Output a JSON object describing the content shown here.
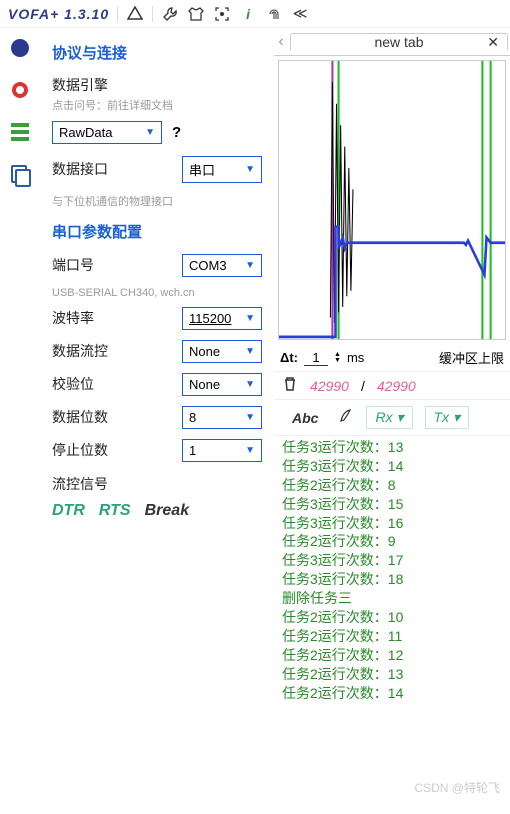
{
  "titlebar": {
    "title": "VOFA+ 1.3.10"
  },
  "leftPanel": {
    "protocol": {
      "title": "协议与连接"
    },
    "engine": {
      "label": "数据引擎",
      "hint": "点击问号：前往详细文档",
      "value": "RawData",
      "help": "?"
    },
    "interface": {
      "label": "数据接口",
      "value": "串口",
      "hint": "与下位机通信的物理接口"
    },
    "serial": {
      "title": "串口参数配置",
      "port": {
        "label": "端口号",
        "value": "COM3",
        "hint": "USB-SERIAL CH340, wch.cn"
      },
      "baud": {
        "label": "波特率",
        "value": "115200"
      },
      "flow": {
        "label": "数据流控",
        "value": "None"
      },
      "parity": {
        "label": "校验位",
        "value": "None"
      },
      "databits": {
        "label": "数据位数",
        "value": "8"
      },
      "stopbits": {
        "label": "停止位数",
        "value": "1"
      },
      "flowsig": {
        "label": "流控信号",
        "dtr": "DTR",
        "rts": "RTS",
        "brk": "Break"
      }
    }
  },
  "rightPanel": {
    "tab": {
      "label": "new tab"
    },
    "dt": {
      "label": "Δt:",
      "value": "1",
      "unit": "ms",
      "buffer_label": "缓冲区上限"
    },
    "buffer": {
      "current": "42990",
      "sep": "/",
      "total": "42990"
    },
    "msgTabs": {
      "abc": "Abc",
      "rx": "Rx",
      "tx": "Tx"
    },
    "log": [
      "任务3运行次数：13",
      "任务3运行次数：14",
      "任务2运行次数：8",
      "任务3运行次数：15",
      "任务3运行次数：16",
      "任务2运行次数：9",
      "任务3运行次数：17",
      "任务3运行次数：18",
      "删除任务三",
      "任务2运行次数：10",
      "任务2运行次数：11",
      "任务2运行次数：12",
      "任务2运行次数：13",
      "任务2运行次数：14"
    ]
  },
  "watermark": "CSDN @特轮飞",
  "chart_data": {
    "type": "line",
    "title": "",
    "xlabel": "",
    "ylabel": "",
    "xlim": [
      0,
      220
    ],
    "ylim": [
      -50,
      200
    ],
    "series": [
      {
        "name": "ch-blue",
        "color": "#2b3fd8",
        "values": [
          [
            0,
            0
          ],
          [
            55,
            0
          ],
          [
            55,
            50
          ],
          [
            75,
            50
          ],
          [
            75,
            40
          ],
          [
            85,
            40
          ],
          [
            85,
            45
          ],
          [
            180,
            45
          ],
          [
            180,
            20
          ],
          [
            200,
            20
          ],
          [
            200,
            45
          ],
          [
            220,
            45
          ]
        ]
      },
      {
        "name": "ch-black",
        "color": "#000",
        "values": [
          [
            50,
            -40
          ],
          [
            55,
            180
          ],
          [
            60,
            -30
          ],
          [
            65,
            150
          ],
          [
            70,
            -20
          ],
          [
            75,
            100
          ]
        ]
      },
      {
        "name": "ch-green1",
        "color": "#1fbf1f",
        "values": [
          [
            58,
            0
          ],
          [
            58,
            200
          ]
        ]
      },
      {
        "name": "ch-green2",
        "color": "#1fbf1f",
        "values": [
          [
            198,
            0
          ],
          [
            198,
            200
          ]
        ]
      },
      {
        "name": "ch-green3",
        "color": "#1fbf1f",
        "values": [
          [
            206,
            0
          ],
          [
            206,
            200
          ]
        ]
      },
      {
        "name": "ch-magenta",
        "color": "#b030b0",
        "values": [
          [
            52,
            0
          ],
          [
            52,
            200
          ]
        ]
      }
    ]
  }
}
